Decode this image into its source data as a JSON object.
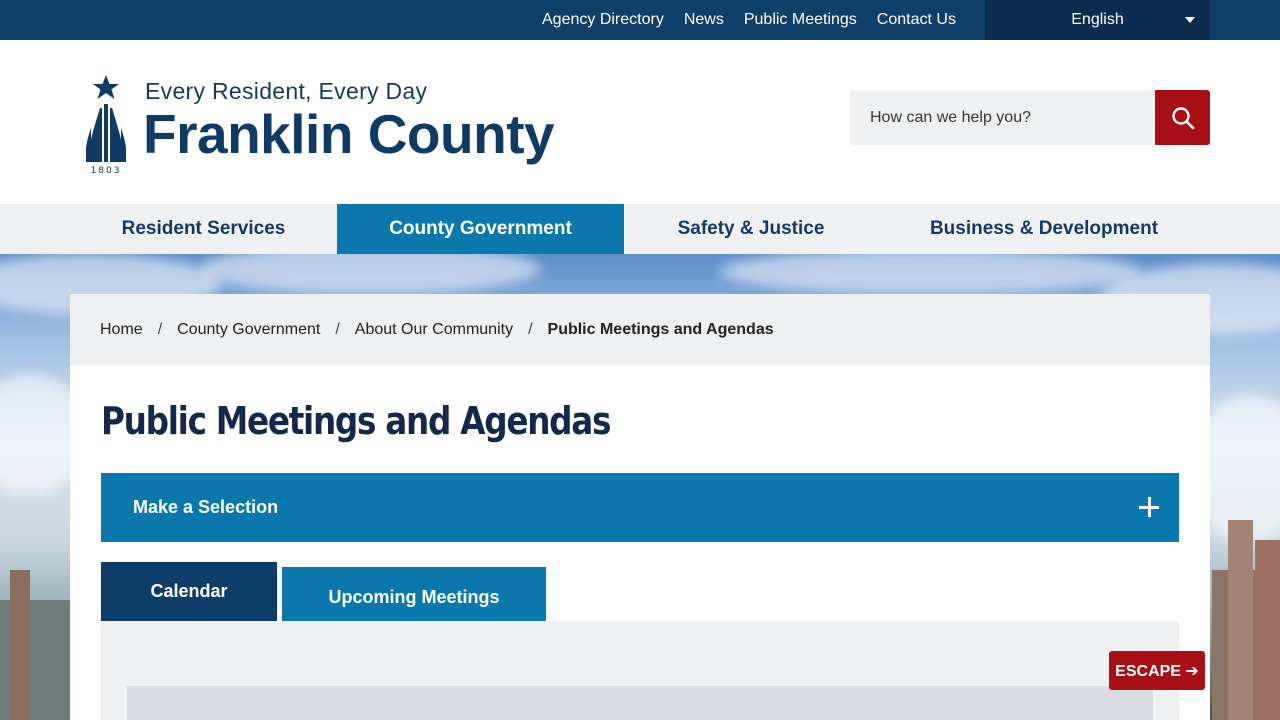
{
  "topbar": {
    "links": [
      "Agency Directory",
      "News",
      "Public Meetings",
      "Contact Us"
    ],
    "language": "English"
  },
  "header": {
    "tagline": "Every Resident, Every Day",
    "title": "Franklin County",
    "logo_year": "1803",
    "search_placeholder": "How can we help you?"
  },
  "nav": {
    "items": [
      "Resident Services",
      "County Government",
      "Safety & Justice",
      "Business & Development"
    ],
    "active": "County Government"
  },
  "breadcrumb": {
    "items": [
      "Home",
      "County Government",
      "About Our Community"
    ],
    "separator": "/",
    "current": "Public Meetings and Agendas"
  },
  "main": {
    "title": "Public Meetings and Agendas",
    "selection_label": "Make a Selection",
    "tabs": [
      "Calendar",
      "Upcoming Meetings"
    ]
  },
  "escape_label": "ESCAPE ➔",
  "colors": {
    "navy": "#0d3f68",
    "blue": "#0a78ad",
    "red": "#a60f14",
    "light_gray": "#eef0f2"
  }
}
